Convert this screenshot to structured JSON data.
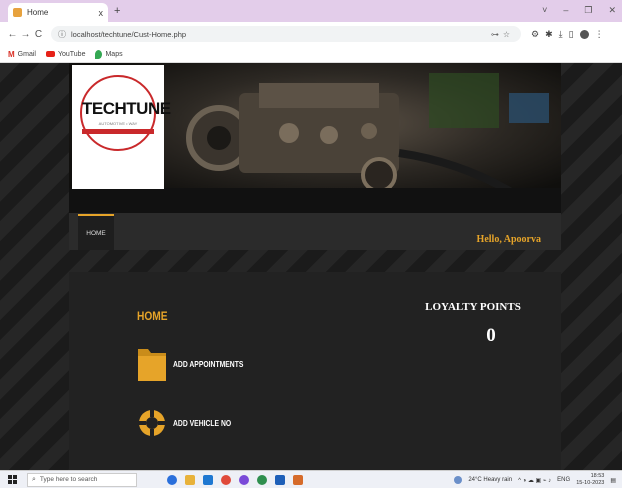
{
  "browser": {
    "tab_title": "Home",
    "tab_close": "x",
    "new_tab": "+",
    "url": "localhost/techtune/Cust-Home.php",
    "bookmarks": [
      "Gmail",
      "YouTube",
      "Maps"
    ],
    "window_controls": [
      "˅",
      "–",
      "❐",
      "✕"
    ]
  },
  "brand": {
    "logo_text": "TECHTUNE",
    "logo_sub": "AUTOMOTIVE • WAY"
  },
  "nav": {
    "home_label": "HOME",
    "greeting": "Hello, Apoorva"
  },
  "main": {
    "title": "HOME",
    "actions": [
      {
        "label": "ADD APPOINTMENTS",
        "icon": "folder-icon"
      },
      {
        "label": "ADD VEHICLE NO",
        "icon": "lifebuoy-icon"
      }
    ],
    "loyalty_title": "LOYALTY POINTS",
    "loyalty_value": "0"
  },
  "taskbar": {
    "search_placeholder": "Type here to search",
    "weather": "24°C  Heavy rain",
    "language": "ENG",
    "time": "18:53",
    "date": "15-10-2023"
  },
  "colors": {
    "accent": "#e6a429",
    "page_bg": "#1f1f1f",
    "panel_bg": "#222222",
    "logo_red": "#c9292b"
  }
}
